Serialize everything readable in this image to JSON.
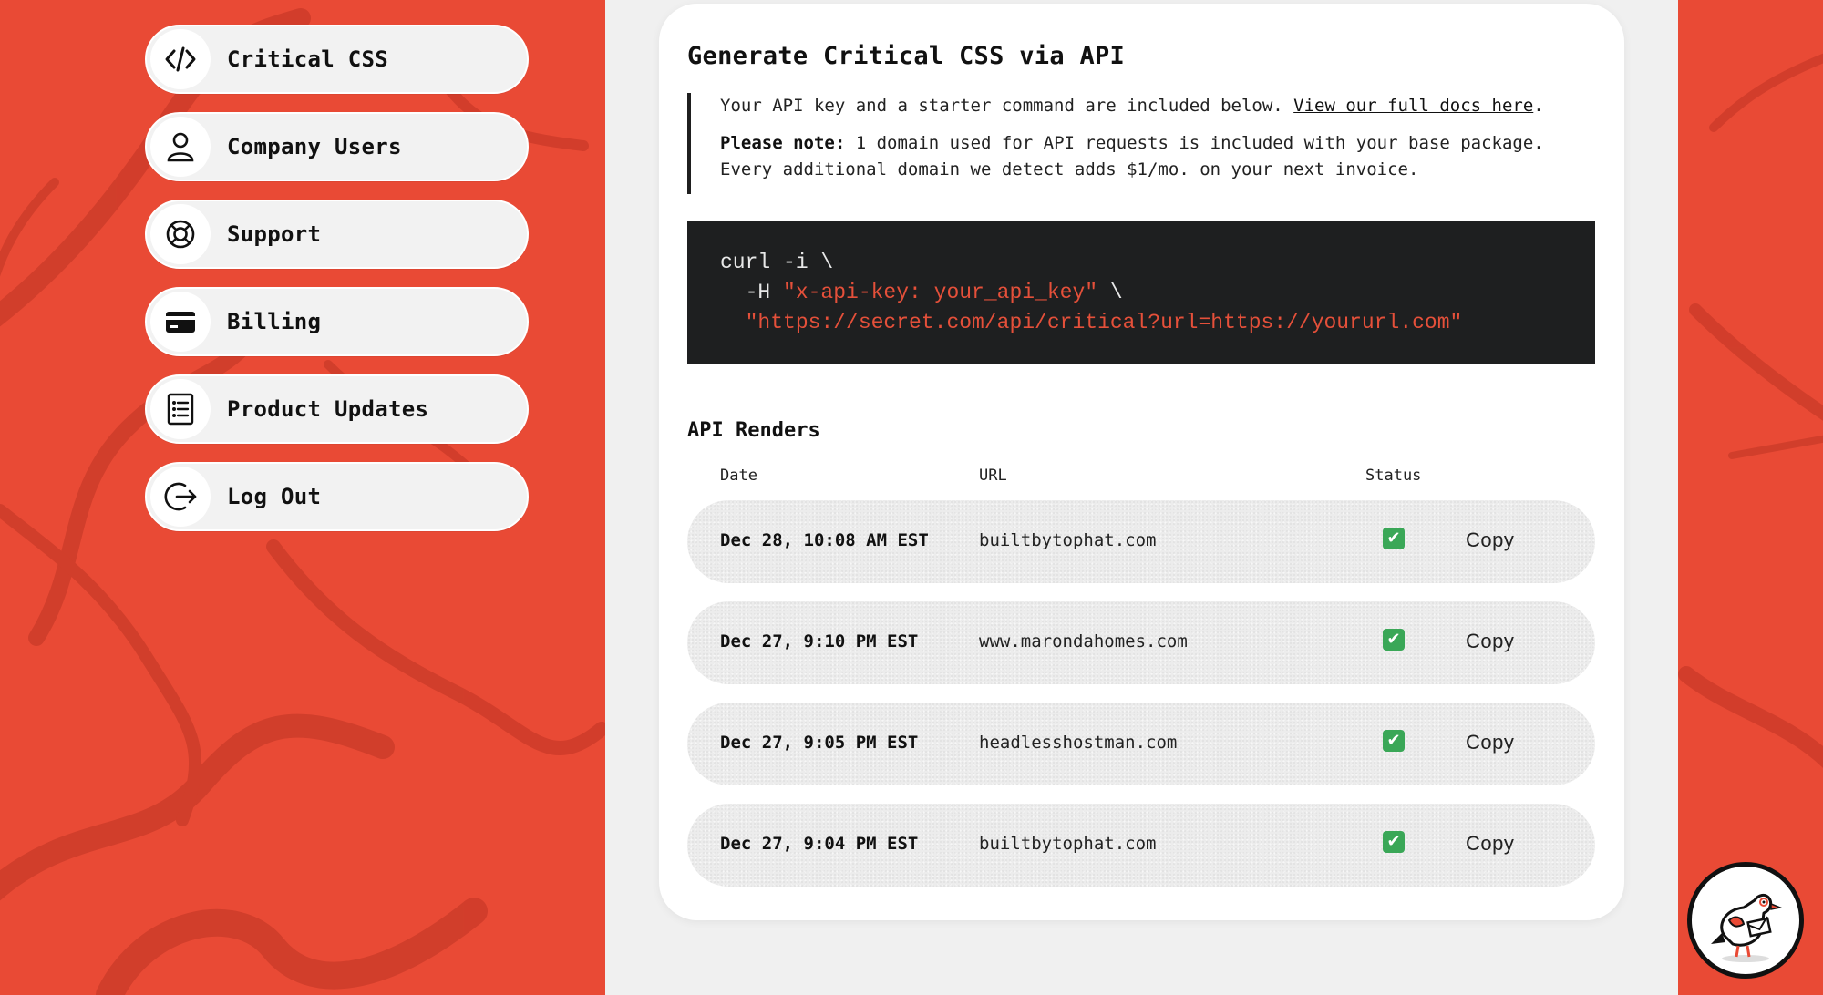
{
  "colors": {
    "accent_red": "#e94a35",
    "code_bg": "#1e1f20",
    "code_string": "#e5503a",
    "status_ok": "#3aa757"
  },
  "sidebar": {
    "items": [
      {
        "label": "Critical CSS",
        "icon": "code-icon"
      },
      {
        "label": "Company Users",
        "icon": "user-icon"
      },
      {
        "label": "Support",
        "icon": "lifebuoy-icon"
      },
      {
        "label": "Billing",
        "icon": "credit-card-icon"
      },
      {
        "label": "Product Updates",
        "icon": "list-icon"
      },
      {
        "label": "Log Out",
        "icon": "logout-icon"
      }
    ]
  },
  "main": {
    "title": "Generate Critical CSS via API",
    "note": {
      "intro": "Your API key and a starter command are included below.",
      "docs_link": "View our full docs here",
      "period": ".",
      "please_note_label": "Please note:",
      "please_note_text": "1 domain used for API requests is included with your base package. Every additional domain we detect adds $1/mo. on your next invoice."
    },
    "code": {
      "line1": "curl -i \\",
      "line2_flag": "  -H ",
      "line2_string": "\"x-api-key: your_api_key\"",
      "line2_tail": " \\",
      "line3_string": "  \"https://secret.com/api/critical?url=https://yoururl.com\""
    },
    "renders": {
      "title": "API Renders",
      "columns": {
        "date": "Date",
        "url": "URL",
        "status": "Status"
      },
      "rows": [
        {
          "date": "Dec 28, 10:08 AM EST",
          "url": "builtbytophat.com",
          "status": "✔",
          "action": "Copy"
        },
        {
          "date": "Dec 27, 9:10 PM EST",
          "url": "www.marondahomes.com",
          "status": "✔",
          "action": "Copy"
        },
        {
          "date": "Dec 27, 9:05 PM EST",
          "url": "headlesshostman.com",
          "status": "✔",
          "action": "Copy"
        },
        {
          "date": "Dec 27, 9:04 PM EST",
          "url": "builtbytophat.com",
          "status": "✔",
          "action": "Copy"
        }
      ]
    }
  },
  "chat": {
    "icon": "pigeon-mascot-icon"
  }
}
